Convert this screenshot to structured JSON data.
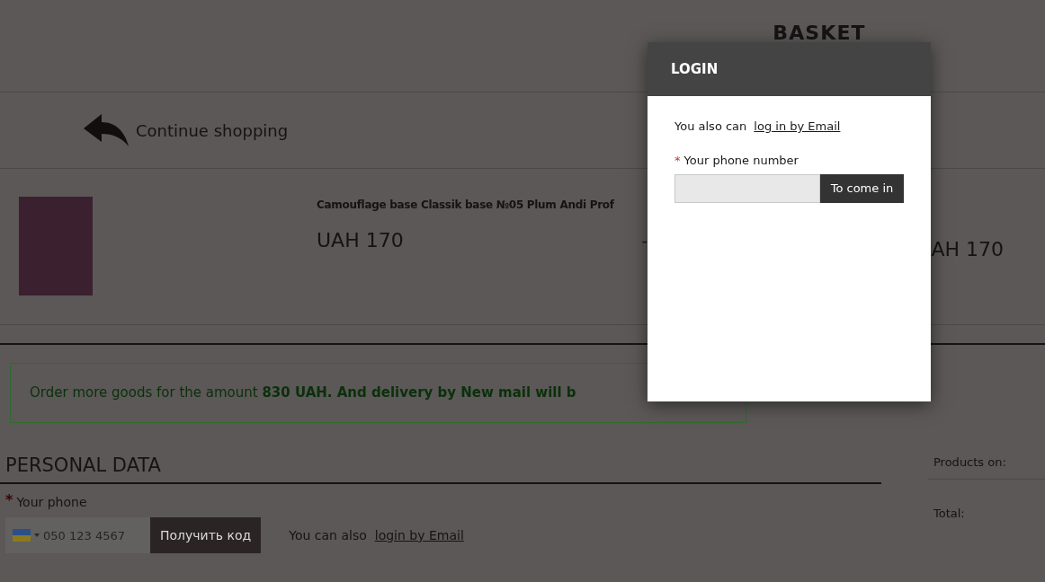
{
  "page": {
    "title": "BASKET",
    "continue_link": "Continue shopping",
    "product": {
      "name": "Camouflage base Classik base №05 Plum Andi Prof",
      "price": "UAH 170",
      "quantity_minus": "-",
      "total": "AH 170"
    },
    "notice": "Order more goods for the amount **830 UAH. And delivery by New mail will b**",
    "personal_data": {
      "heading": "PERSONAL DATA",
      "phone_label": "Your phone",
      "required_mark": "*",
      "phone_placeholder": "050 123 4567",
      "get_code_button": "Получить код",
      "alt_text": "You can also",
      "alt_link": "login by Email"
    },
    "summary": {
      "products_label": "Products on:",
      "total_label": "Total:"
    }
  },
  "modal": {
    "title": "LOGIN",
    "alt_text": "You also can",
    "alt_link": "log in by Email",
    "required_mark": "*",
    "phone_label": "Your phone number",
    "submit_button": "To come in"
  }
}
